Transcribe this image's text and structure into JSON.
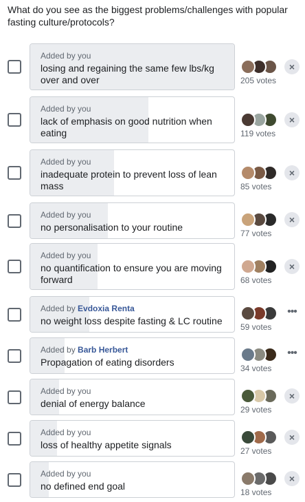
{
  "question": "What do you see as the biggest problems/challenges with popular fasting culture/protocols?",
  "added_by_prefix": "Added by",
  "options": [
    {
      "label": "losing and regaining the same few lbs/kg over and over",
      "added_by": "you",
      "votes": "205 votes",
      "action": "remove",
      "avatars": [
        "#8a6d5a",
        "#3e2f2a",
        "#6b5548"
      ]
    },
    {
      "label": "lack of emphasis on good nutrition when eating",
      "added_by": "you",
      "votes": "119 votes",
      "action": "remove",
      "avatars": [
        "#4a3a33",
        "#9aa5a0",
        "#3f4a30"
      ]
    },
    {
      "label": "inadequate protein to prevent loss of lean mass",
      "added_by": "you",
      "votes": "85 votes",
      "action": "remove",
      "avatars": [
        "#b48a6a",
        "#7a5a45",
        "#2f2a28"
      ]
    },
    {
      "label": "no personalisation to your routine",
      "added_by": "you",
      "votes": "77 votes",
      "action": "remove",
      "avatars": [
        "#c9a37a",
        "#5a4a40",
        "#2a2a2a"
      ]
    },
    {
      "label": "no quantification to ensure you are moving forward",
      "added_by": "you",
      "votes": "68 votes",
      "action": "remove",
      "avatars": [
        "#d0a890",
        "#a08060",
        "#222222"
      ]
    },
    {
      "label": "no weight loss despite fasting & LC routine",
      "added_by": "Evdoxia Renta",
      "votes": "59 votes",
      "action": "more",
      "avatars": [
        "#5a4a40",
        "#7a3a2a",
        "#3a3a3a"
      ]
    },
    {
      "label": "Propagation of eating disorders",
      "added_by": "Barb Herbert",
      "votes": "34 votes",
      "action": "more",
      "avatars": [
        "#6a7a8a",
        "#8a8a80",
        "#3a2a1a"
      ]
    },
    {
      "label": "denial of energy balance",
      "added_by": "you",
      "votes": "29 votes",
      "action": "remove",
      "avatars": [
        "#4a5a3a",
        "#d8c8a8",
        "#6a6a5a"
      ]
    },
    {
      "label": "loss of healthy appetite signals",
      "added_by": "you",
      "votes": "27 votes",
      "action": "remove",
      "avatars": [
        "#3a4a3a",
        "#a06a4a",
        "#5a5a5a"
      ]
    },
    {
      "label": "no defined end goal",
      "added_by": "you",
      "votes": "18 votes",
      "action": "remove",
      "avatars": [
        "#8a7a6a",
        "#6a6a6a",
        "#4a4a4a"
      ]
    }
  ],
  "vote_share": [
    1.0,
    0.58,
    0.41,
    0.38,
    0.33,
    0.29,
    0.17,
    0.14,
    0.13,
    0.09
  ],
  "colors": {
    "link": "#385898",
    "fill": "#ebedf0",
    "border": "#ccd0d5",
    "muted": "#606770"
  },
  "icons": {
    "remove": "close-icon",
    "more": "more-icon"
  }
}
